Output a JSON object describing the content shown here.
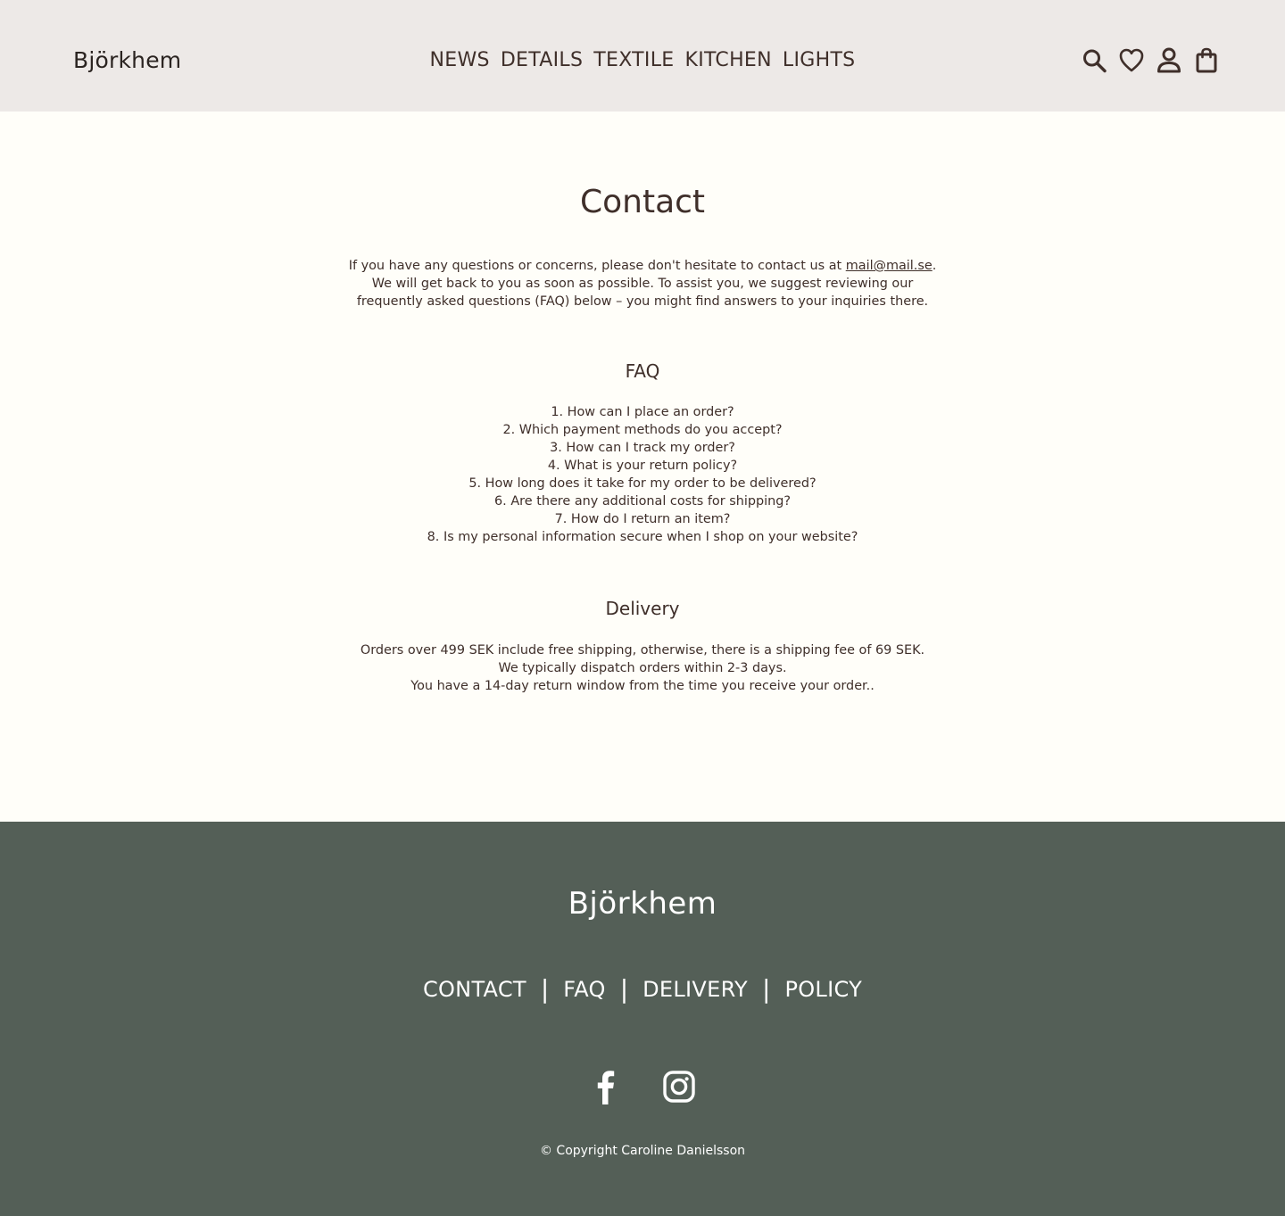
{
  "header": {
    "brand": "Björkhem",
    "nav": [
      "NEWS",
      "DETAILS",
      "TEXTILE",
      "KITCHEN",
      "LIGHTS"
    ],
    "icons": [
      "search-icon",
      "heart-icon",
      "user-icon",
      "shopping-bag-icon"
    ]
  },
  "main": {
    "title": "Contact",
    "intro": {
      "line1_before": "If you have any questions or concerns, please don't hesitate to contact us at ",
      "email": "mail@mail.se",
      "line1_after": ".",
      "line2": "We will get back to you as soon as possible. To assist you, we suggest reviewing our",
      "line3": "frequently asked questions (FAQ) below – you might find answers to your inquiries there."
    },
    "faq": {
      "title": "FAQ",
      "items": [
        "1. How can I place an order?",
        "2. Which payment methods do you accept?",
        "3. How can I track my order?",
        "4. What is your return policy?",
        "5. How long does it take for my order to be delivered?",
        "6. Are there any additional costs for shipping?",
        "7. How do I return an item?",
        "8. Is my personal information secure when I shop on your website?"
      ]
    },
    "delivery": {
      "title": "Delivery",
      "lines": [
        "Orders over 499 SEK include free shipping, otherwise, there is a shipping fee of 69 SEK.",
        "We typically dispatch orders within 2-3 days.",
        "You have a 14-day return window from the time you receive your order.."
      ]
    }
  },
  "footer": {
    "brand": "Björkhem",
    "nav": [
      "CONTACT",
      "FAQ",
      "DELIVERY",
      "POLICY"
    ],
    "separator": "|",
    "social": [
      "facebook-icon",
      "instagram-icon"
    ],
    "copyright": "© Copyright Caroline Danielsson"
  },
  "colors": {
    "header_bg": "#ede9e7",
    "page_bg": "#fffef9",
    "text": "#3f2f2a",
    "footer_bg": "#545f57",
    "footer_text": "#ffffff"
  }
}
